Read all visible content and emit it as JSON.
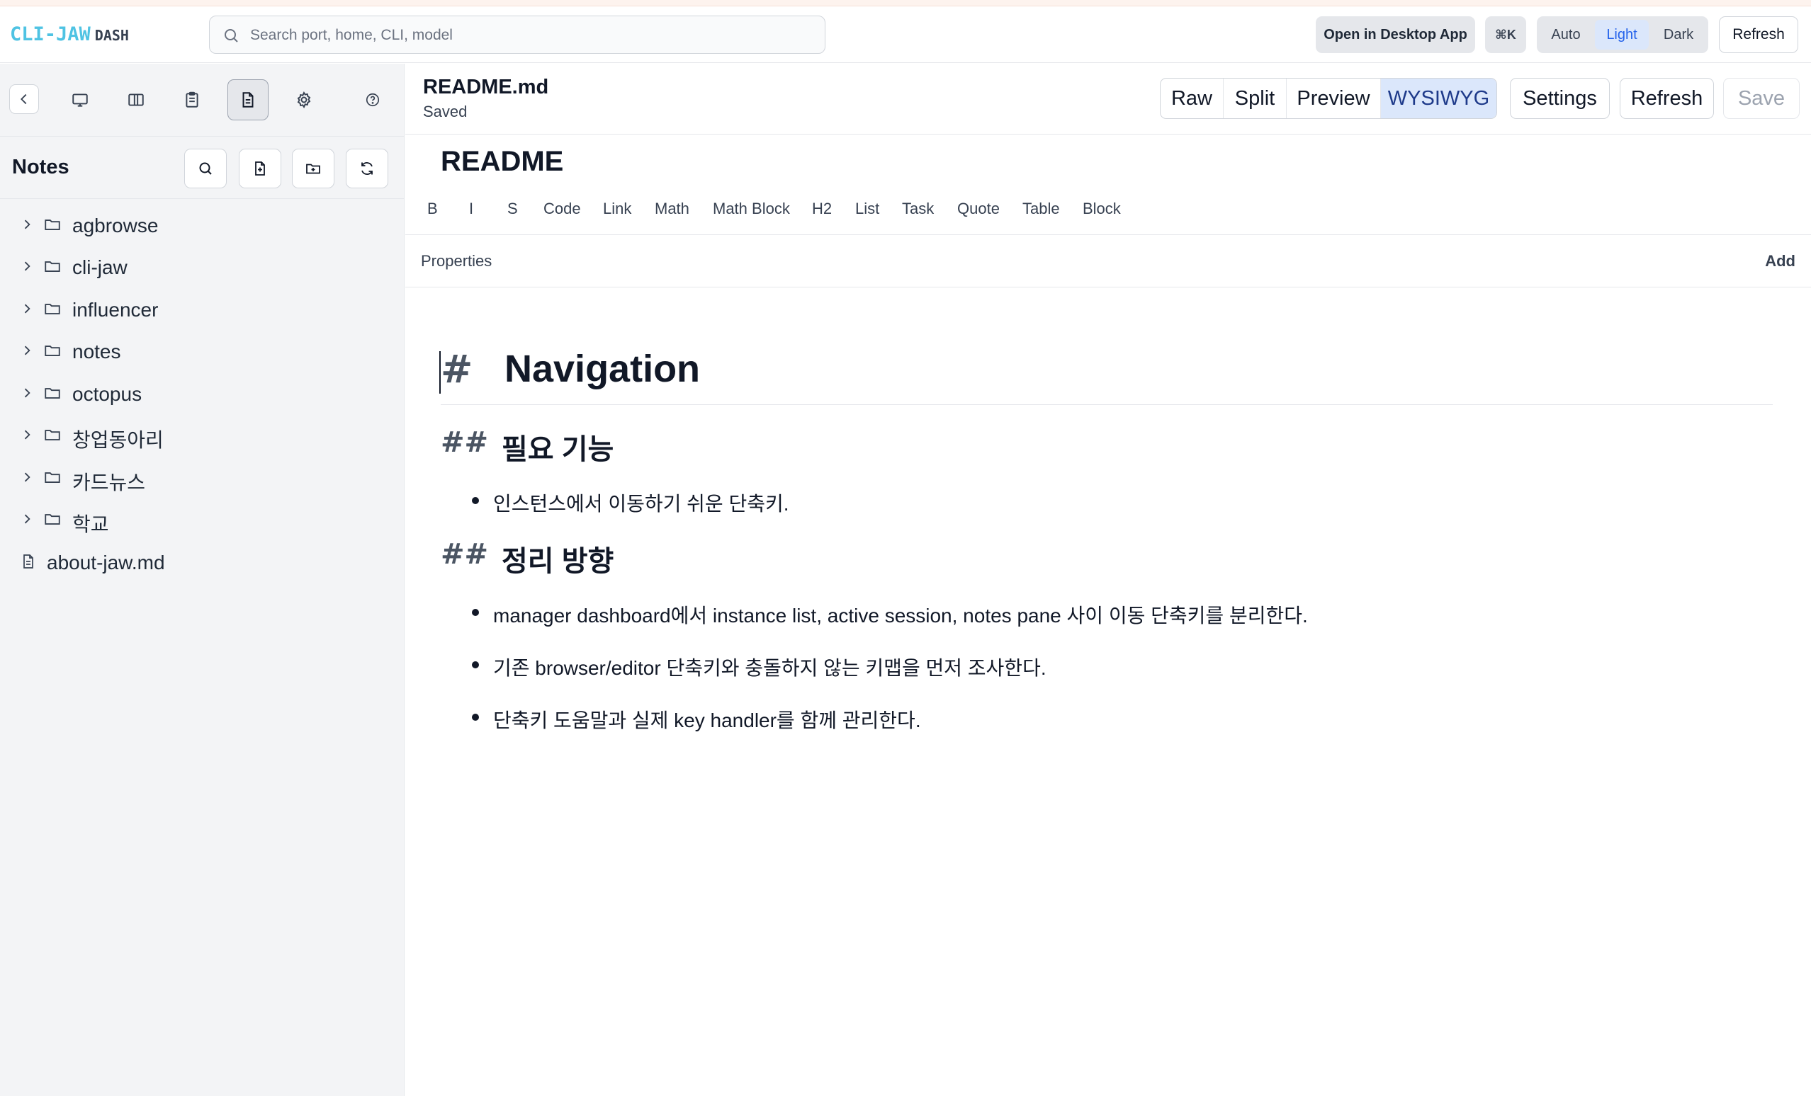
{
  "brand": {
    "name": "CLI-JAW",
    "suffix": "DASH"
  },
  "search": {
    "placeholder": "Search port, home, CLI, model"
  },
  "header": {
    "open_desktop_label": "Open in Desktop App",
    "shortcut_label": "⌘K",
    "theme_options": [
      "Auto",
      "Light",
      "Dark"
    ],
    "theme_selected": "Light",
    "refresh_label": "Refresh"
  },
  "sidebar": {
    "icons": [
      "chevron-left-icon",
      "monitor-icon",
      "columns-icon",
      "clipboard-icon",
      "file-text-icon",
      "gear-icon",
      "help-circle-icon"
    ],
    "active_icon": "file-text-icon",
    "notes_title": "Notes",
    "tree": [
      {
        "type": "folder",
        "label": "agbrowse"
      },
      {
        "type": "folder",
        "label": "cli-jaw"
      },
      {
        "type": "folder",
        "label": "influencer"
      },
      {
        "type": "folder",
        "label": "notes"
      },
      {
        "type": "folder",
        "label": "octopus"
      },
      {
        "type": "folder",
        "label": "창업동아리"
      },
      {
        "type": "folder",
        "label": "카드뉴스"
      },
      {
        "type": "folder",
        "label": "학교"
      },
      {
        "type": "file",
        "label": "about-jaw.md"
      }
    ]
  },
  "document": {
    "filename": "README.md",
    "status": "Saved",
    "modes": [
      "Raw",
      "Split",
      "Preview",
      "WYSIWYG"
    ],
    "mode_selected": "WYSIWYG",
    "settings_label": "Settings",
    "refresh_label": "Refresh",
    "save_label": "Save"
  },
  "editor": {
    "title": "README",
    "toolbar": [
      "B",
      "I",
      "S",
      "Code",
      "Link",
      "Math",
      "Math Block",
      "H2",
      "List",
      "Task",
      "Quote",
      "Table",
      "Block"
    ],
    "properties_label": "Properties",
    "add_label": "Add",
    "h1_mark": "#",
    "h2_mark": "##",
    "h1": "Navigation",
    "sections": [
      {
        "heading": "필요 기능",
        "items": [
          "인스턴스에서 이동하기 쉬운 단축키."
        ]
      },
      {
        "heading": "정리 방향",
        "items": [
          "manager dashboard에서 instance list, active session, notes pane 사이 이동 단축키를 분리한다.",
          "기존 browser/editor 단축키와 충돌하지 않는 키맵을 먼저 조사한다.",
          "단축키 도움말과 실제 key handler를 함께 관리한다."
        ]
      }
    ]
  }
}
